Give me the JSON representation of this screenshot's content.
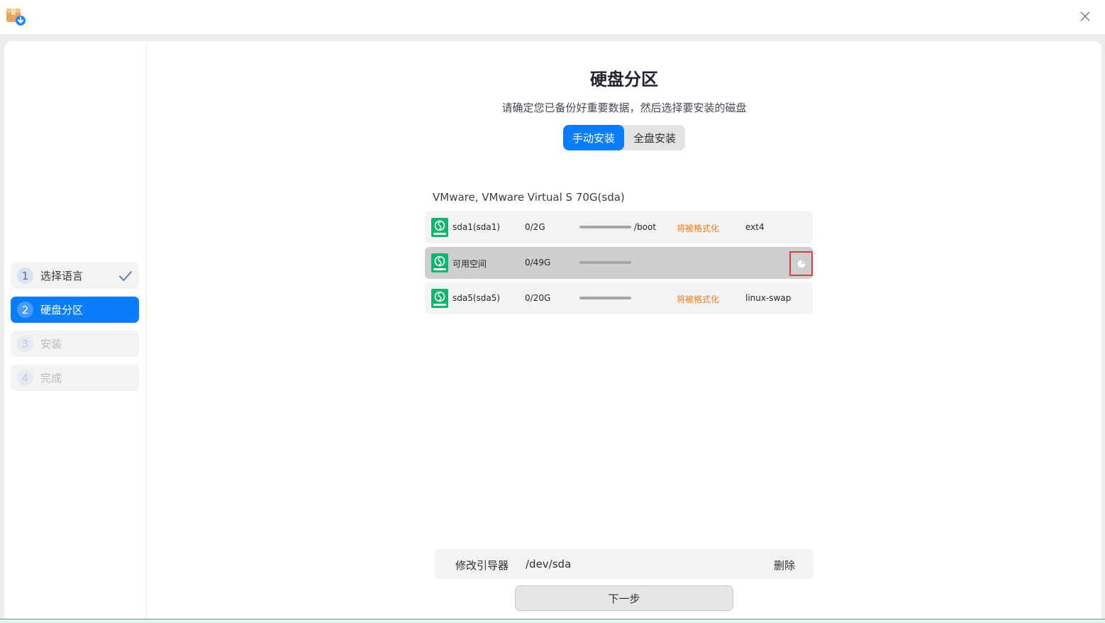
{
  "window": {
    "close_icon": "close-icon",
    "app_icon": "installer-package-icon"
  },
  "sidebar": {
    "steps": [
      {
        "num": "1",
        "label": "选择语言",
        "state": "done"
      },
      {
        "num": "2",
        "label": "硬盘分区",
        "state": "active"
      },
      {
        "num": "3",
        "label": "安装",
        "state": "disabled"
      },
      {
        "num": "4",
        "label": "完成",
        "state": "disabled"
      }
    ]
  },
  "main": {
    "title": "硬盘分区",
    "subtitle": "请确定您已备份好重要数据，然后选择要安装的磁盘",
    "modes": [
      {
        "label": "手动安装",
        "active": true
      },
      {
        "label": "全盘安装",
        "active": false
      }
    ],
    "disk": {
      "name": "VMware, VMware Virtual S 70G(sda)",
      "partitions": [
        {
          "name": "sda1(sda1)",
          "size": "0/2G",
          "usage": 0,
          "mount": "/boot",
          "format": "将被格式化",
          "fs": "ext4",
          "selected": false
        },
        {
          "name": "可用空间",
          "size": "0/49G",
          "usage": 0,
          "mount": "",
          "format": "",
          "fs": "",
          "selected": true
        },
        {
          "name": "sda5(sda5)",
          "size": "0/20G",
          "usage": 0,
          "mount": "",
          "format": "将被格式化",
          "fs": "linux-swap",
          "selected": false
        }
      ]
    },
    "bootloader": {
      "label": "修改引导器",
      "device": "/dev/sda",
      "delete": "删除"
    },
    "next_button": "下一步"
  },
  "colors": {
    "accent": "#0a7dfc",
    "warning": "#f27a16",
    "highlight": "#e23b3b"
  }
}
